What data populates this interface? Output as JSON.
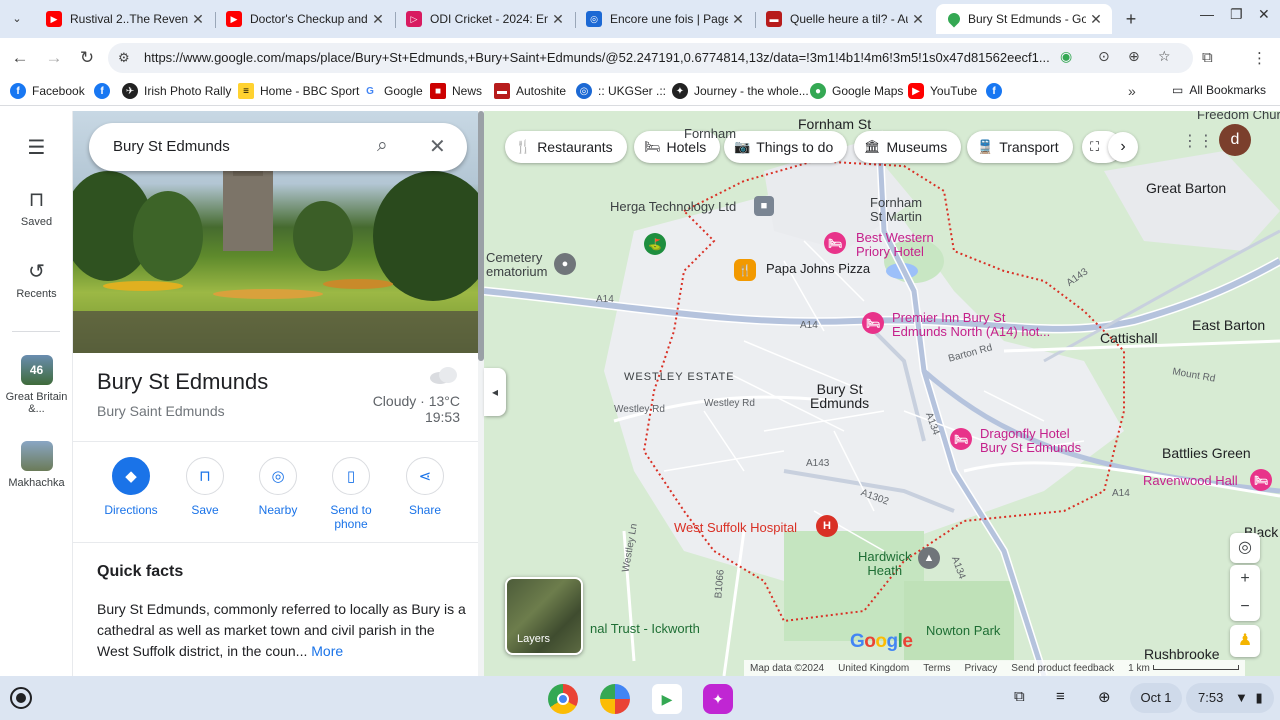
{
  "browser": {
    "tabs": [
      {
        "label": "Rustival 2..The Revenge",
        "icon_color": "#ff0000",
        "icon_glyph": "▶"
      },
      {
        "label": "Doctor's Checkup and T",
        "icon_color": "#ff0000",
        "icon_glyph": "▶"
      },
      {
        "label": "ODI Cricket - 2024: Eng",
        "icon_color": "#d81b60",
        "icon_glyph": "▷"
      },
      {
        "label": "Encore une fois | Page",
        "icon_color": "#1c69d4",
        "icon_glyph": "◎"
      },
      {
        "label": "Quelle heure a til? - Aut",
        "icon_color": "#b71c1c",
        "icon_glyph": "🚗"
      },
      {
        "label": "Bury St Edmunds - Goo",
        "icon_color": "#34a853",
        "icon_glyph": "📍"
      }
    ],
    "url": "https://www.google.com/maps/place/Bury+St+Edmunds,+Bury+Saint+Edmunds/@52.247191,0.6774814,13z/data=!3m1!4b1!4m6!3m5!1s0x47d81562eecf1...",
    "bookmarks": [
      {
        "label": "Facebook",
        "color": "#1877f2",
        "glyph": "f"
      },
      {
        "label": "",
        "color": "#1877f2",
        "glyph": "f"
      },
      {
        "label": "Irish Photo Rally",
        "color": "#222222",
        "glyph": "✈"
      },
      {
        "label": "Home - BBC Sport",
        "color": "#ffd230",
        "glyph": "≡"
      },
      {
        "label": "Google",
        "color": "#ffffff",
        "glyph": "G"
      },
      {
        "label": "News",
        "color": "#cc0000",
        "glyph": "■"
      },
      {
        "label": "Autoshite",
        "color": "#b71c1c",
        "glyph": "🚗"
      },
      {
        "label": ":: UKGSer .::",
        "color": "#1c69d4",
        "glyph": "◎"
      },
      {
        "label": "Journey - the whole...",
        "color": "#222222",
        "glyph": "✦"
      },
      {
        "label": "Google Maps",
        "color": "#34a853",
        "glyph": "📍"
      },
      {
        "label": "YouTube",
        "color": "#ff0000",
        "glyph": "▶"
      },
      {
        "label": "",
        "color": "#1877f2",
        "glyph": "f"
      }
    ],
    "all_bookmarks": "All Bookmarks"
  },
  "rail": {
    "saved": "Saved",
    "recents": "Recents",
    "recent_places": [
      {
        "label": "Great Britain &...",
        "badge": "46"
      },
      {
        "label": "Makhachka",
        "badge": ""
      }
    ]
  },
  "panel": {
    "search_value": "Bury St Edmunds",
    "place_name": "Bury St Edmunds",
    "place_sub": "Bury Saint Edmunds",
    "weather": "Cloudy · 13°C",
    "time": "19:53",
    "actions": [
      "Directions",
      "Save",
      "Nearby",
      "Send to phone",
      "Share"
    ],
    "quick_facts_title": "Quick facts",
    "quick_facts_body": "Bury St Edmunds, commonly referred to locally as Bury is a cathedral as well as market town and civil parish in the West Suffolk district, in the coun...",
    "more": "More"
  },
  "map": {
    "chips": [
      "Restaurants",
      "Hotels",
      "Things to do",
      "Museums",
      "Transport"
    ],
    "avatar": "d",
    "layers": "Layers",
    "labels": {
      "fornham_top": "Fornham St",
      "fornham_top2": "Fornham",
      "great_barton": "Great Barton",
      "herga": "Herga Technology Ltd",
      "fornham_martin": "Fornham\nSt Martin",
      "best_western": "Best Western\nPriory Hotel",
      "papa_johns": "Papa Johns Pizza",
      "cemetery": "Cemetery\nematorium",
      "premier_inn": "Premier Inn Bury St\nEdmunds North (A14) hot...",
      "cattishall": "Cattishall",
      "east_barton": "East Barton",
      "westley_estate": "WESTLEY ESTATE",
      "bury_center": "Bury St\nEdmunds",
      "dragonfly": "Dragonfly Hotel\nBury St Edmunds",
      "battlies": "Battlies Green",
      "ravenwood": "Ravenwood Hall",
      "west_suffolk": "West Suffolk Hospital",
      "hardwick": "Hardwick\nHeath",
      "black": "Black",
      "ickworth": "nal Trust - Ickworth",
      "nowton": "Nowton Park",
      "rushbrooke": "Rushbrooke",
      "freedom": "Freedom Churc",
      "a14_left": "A14",
      "a14_mid": "A14",
      "a14_right": "A14",
      "a143_top": "A143",
      "a143": "A143",
      "a1302": "A1302",
      "a134": "A134",
      "a134b": "A134",
      "b1066": "B1066",
      "westley_rd": "Westley Rd",
      "westley_rd2": "Westley Rd",
      "westley_ln": "Westley Ln",
      "barton_rd": "Barton Rd",
      "mount_rd": "Mount Rd"
    },
    "attribution": [
      "Map data ©2024",
      "United Kingdom",
      "Terms",
      "Privacy",
      "Send product feedback",
      "1 km"
    ]
  },
  "shelf": {
    "date": "Oct 1",
    "time": "7:53"
  }
}
